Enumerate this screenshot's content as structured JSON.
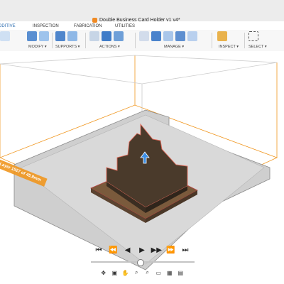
{
  "window": {
    "title": "Double Business Card Holder v1 v4*"
  },
  "tabs": [
    {
      "label": "ADDITIVE",
      "active": true
    },
    {
      "label": "INSPECTION",
      "active": false
    },
    {
      "label": "FABRICATION",
      "active": false
    },
    {
      "label": "UTILITIES",
      "active": false
    }
  ],
  "ribbon": {
    "groups": [
      {
        "label": "MODIFY ▾"
      },
      {
        "label": "SUPPORTS ▾"
      },
      {
        "label": "ACTIONS ▾"
      },
      {
        "label": "MANAGE ▾"
      },
      {
        "label": "INSPECT ▾"
      },
      {
        "label": "SELECT ▾"
      }
    ]
  },
  "viewport": {
    "layer_label": "Layer 1527 of 45.8mm",
    "accent_color": "#f0961e",
    "model_color": "#4a3a2b"
  },
  "playback": {
    "buttons": [
      "⏮",
      "⏪",
      "◀",
      "▶",
      "▶▶",
      "⏩",
      "⏭"
    ],
    "slider_fraction": 0.48
  },
  "navbar": {
    "icons": [
      "orbit-icon",
      "hand-icon",
      "zoom-icon",
      "fit-icon",
      "display-icon",
      "grid-icon",
      "view-icon"
    ]
  }
}
